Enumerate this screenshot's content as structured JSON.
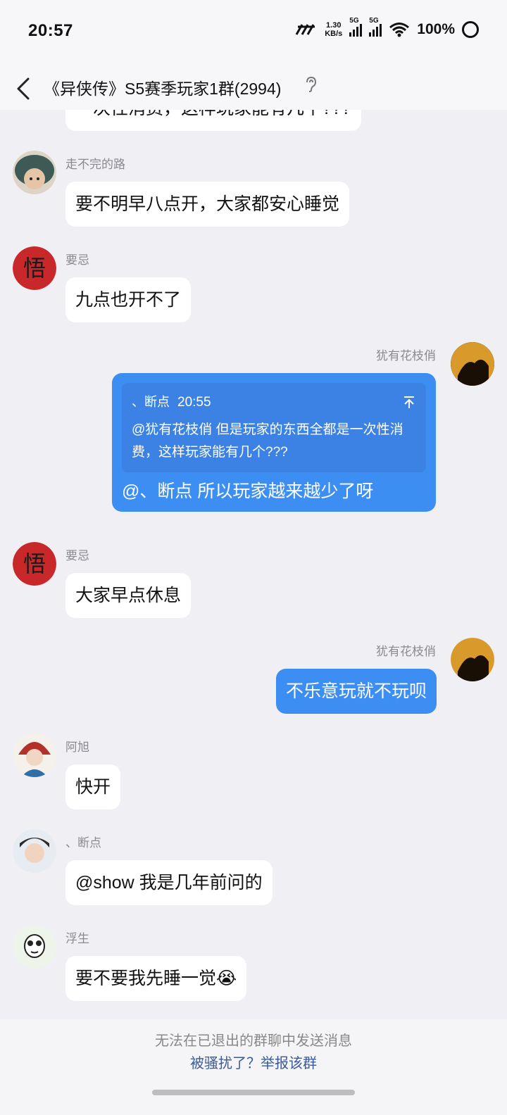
{
  "status": {
    "time": "20:57",
    "net_speed_top": "1.30",
    "net_speed_bottom": "KB/s",
    "sim1": "5G",
    "sim2": "5G",
    "battery": "100%"
  },
  "header": {
    "title": "《异侠传》S5赛季玩家1群(2994)"
  },
  "messages": [
    {
      "text": "一次性消费，这样玩家能有几个???"
    },
    {
      "nick": "走不完的路",
      "text": "要不明早八点开，大家都安心睡觉"
    },
    {
      "nick": "要忌",
      "text": "九点也开不了",
      "avatar_char": "悟"
    },
    {
      "nick": "犹有花枝俏",
      "quote_name": "、断点",
      "quote_time": "20:55",
      "quote_text": "@犹有花枝俏 但是玩家的东西全都是一次性消费，这样玩家能有几个???",
      "text": "@、断点 所以玩家越来越少了呀"
    },
    {
      "nick": "要忌",
      "text": "大家早点休息",
      "avatar_char": "悟"
    },
    {
      "nick": "犹有花枝俏",
      "text": "不乐意玩就不玩呗"
    },
    {
      "nick": "阿旭",
      "text": "快开"
    },
    {
      "nick": "、断点",
      "text": "@show 我是几年前问的"
    },
    {
      "nick": "浮生",
      "text": "要不要我先睡一觉",
      "emoji": "😭"
    }
  ],
  "footer": {
    "note": "无法在已退出的群聊中发送消息",
    "report": "被骚扰了？举报该群"
  },
  "colors": {
    "background": "#efeff4",
    "my_bubble": "#3d8ef2",
    "report_link": "#3a5a98"
  }
}
